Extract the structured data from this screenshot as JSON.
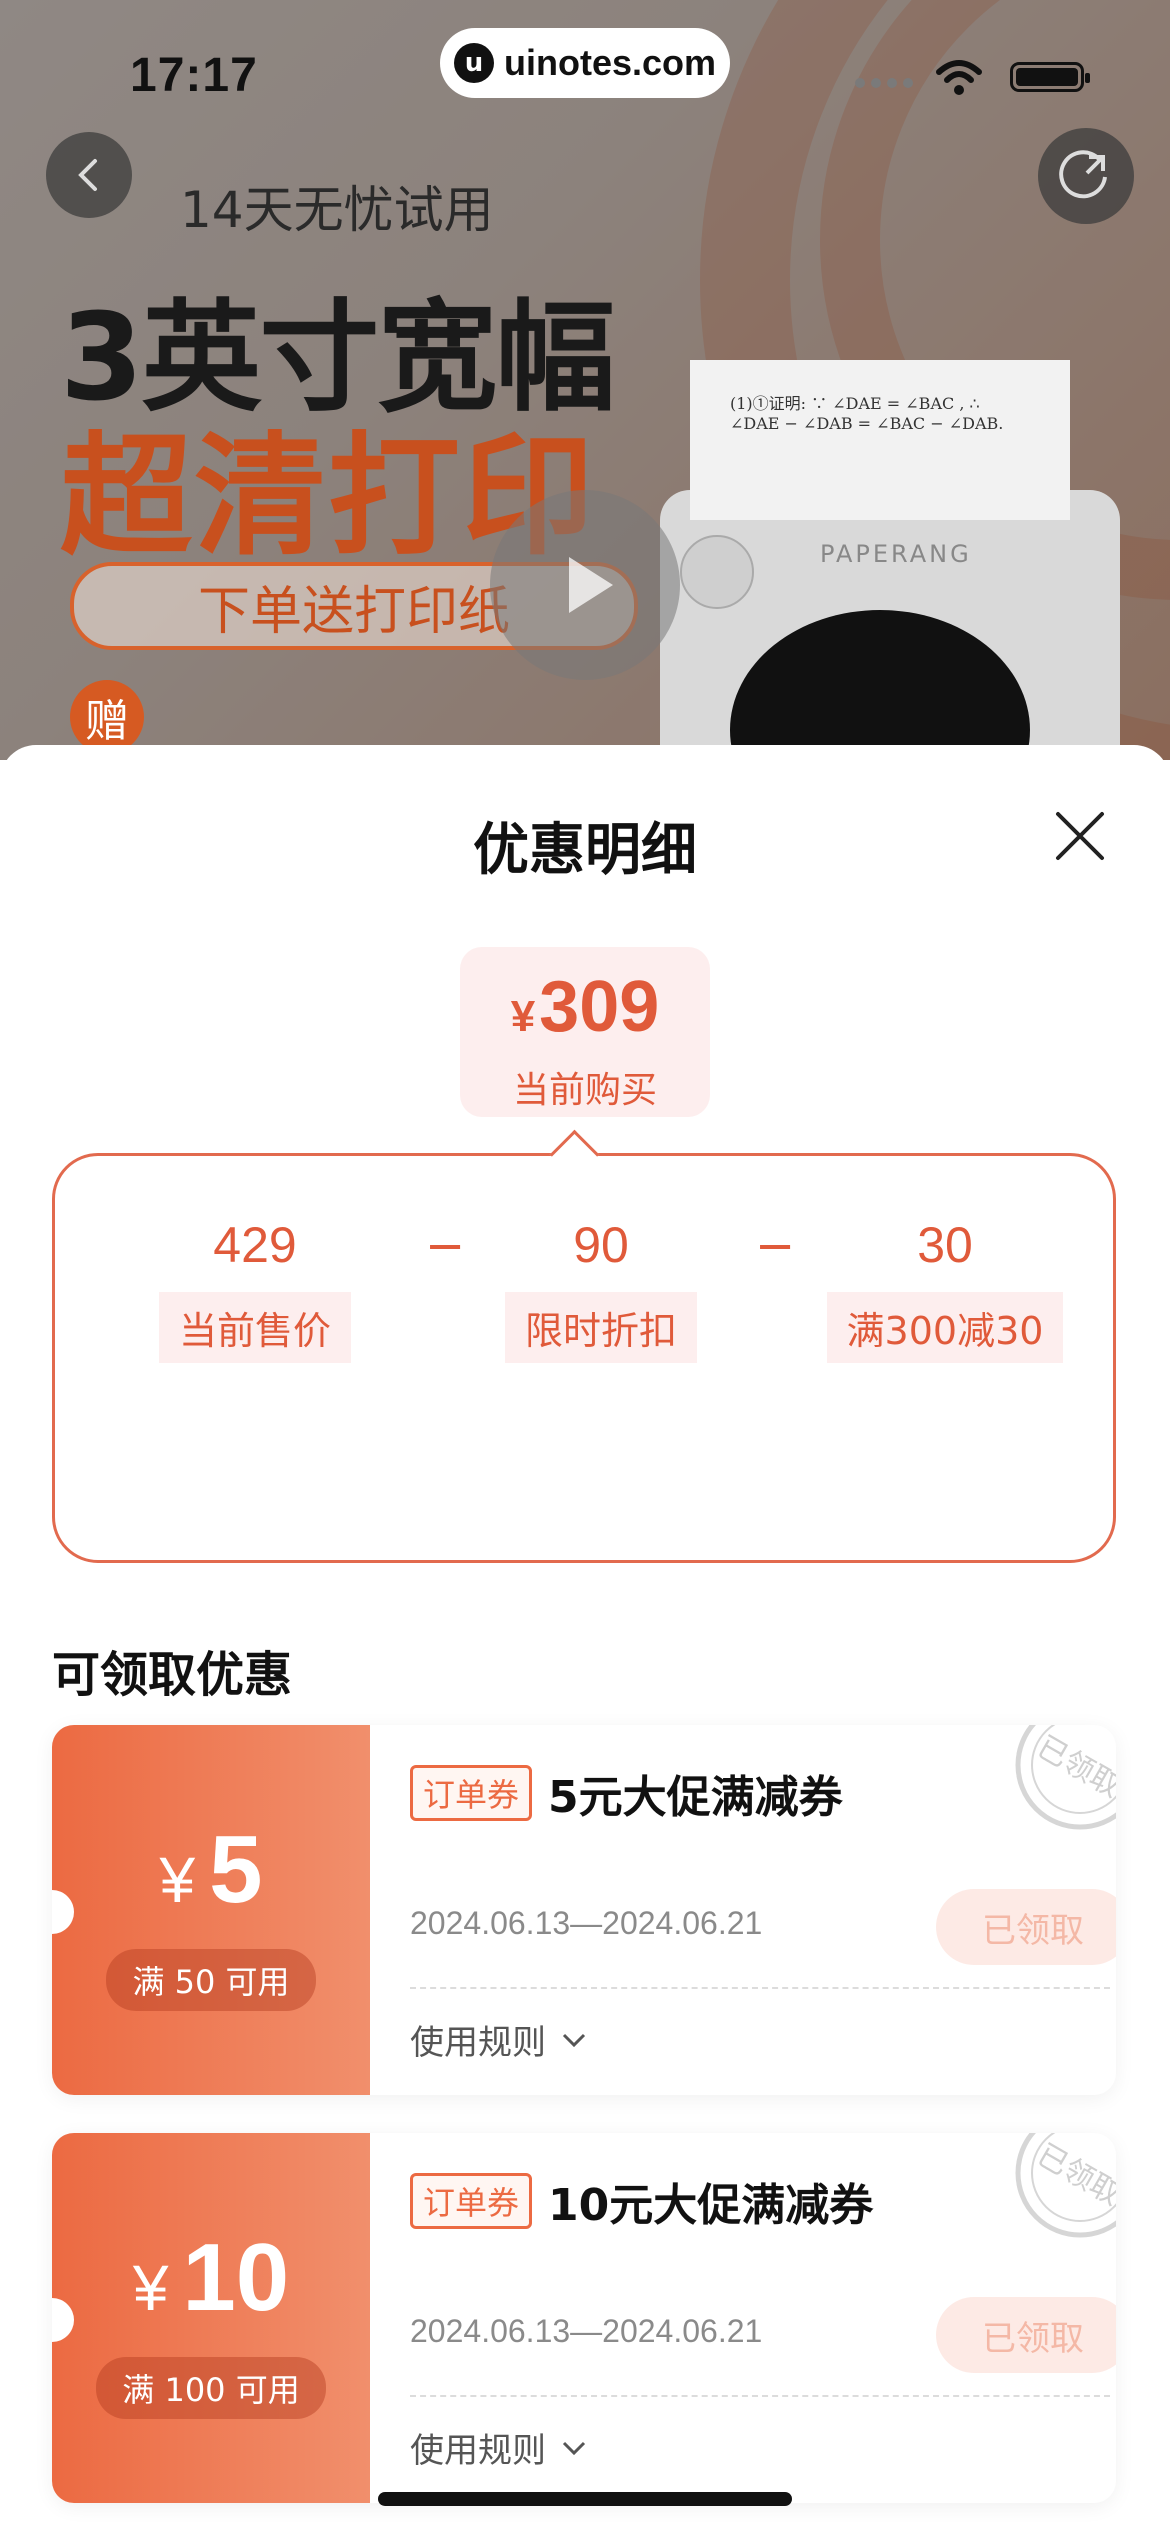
{
  "status_bar": {
    "time": "17:17",
    "watermark": "uinotes.com"
  },
  "banner": {
    "subtitle": "14天无忧试用",
    "headline_1": "3英寸宽幅",
    "headline_2": "超清打印",
    "gift_text": "下单送打印纸",
    "gift_badge": "赠",
    "printer_brand": "PAPERANG",
    "paper_text": "(1)①证明: ∵ ∠DAE = ∠BAC , ∴ ∠DAE − ∠DAB = ∠BAC − ∠DAB."
  },
  "sheet": {
    "title": "优惠明细",
    "current_price": {
      "currency": "¥",
      "amount": "309",
      "label": "当前购买"
    },
    "breakdown": [
      {
        "value": "429",
        "label": "当前售价"
      },
      {
        "value": "90",
        "label": "限时折扣"
      },
      {
        "value": "30",
        "label": "满300减30"
      }
    ],
    "operator": "−",
    "section_title": "可领取优惠",
    "coupons": [
      {
        "currency": "¥",
        "amount": "5",
        "condition": "满 50 可用",
        "tag": "订单券",
        "name": "5元大促满减券",
        "date": "2024.06.13—2024.06.21",
        "button": "已领取",
        "rules": "使用规则",
        "stamp": "已领取"
      },
      {
        "currency": "¥",
        "amount": "10",
        "condition": "满 100 可用",
        "tag": "订单券",
        "name": "10元大促满减券",
        "date": "2024.06.13—2024.06.21",
        "button": "已领取",
        "rules": "使用规则",
        "stamp": "已领取"
      }
    ]
  },
  "colors": {
    "accent": "#e05a3a",
    "coupon_start": "#ec6a42",
    "coupon_end": "#f18f6c",
    "price_bg": "#fdeeee"
  },
  "icons": [
    "back-icon",
    "share-icon",
    "play-icon",
    "close-icon",
    "chevron-down-icon",
    "wifi-icon",
    "battery-icon"
  ]
}
